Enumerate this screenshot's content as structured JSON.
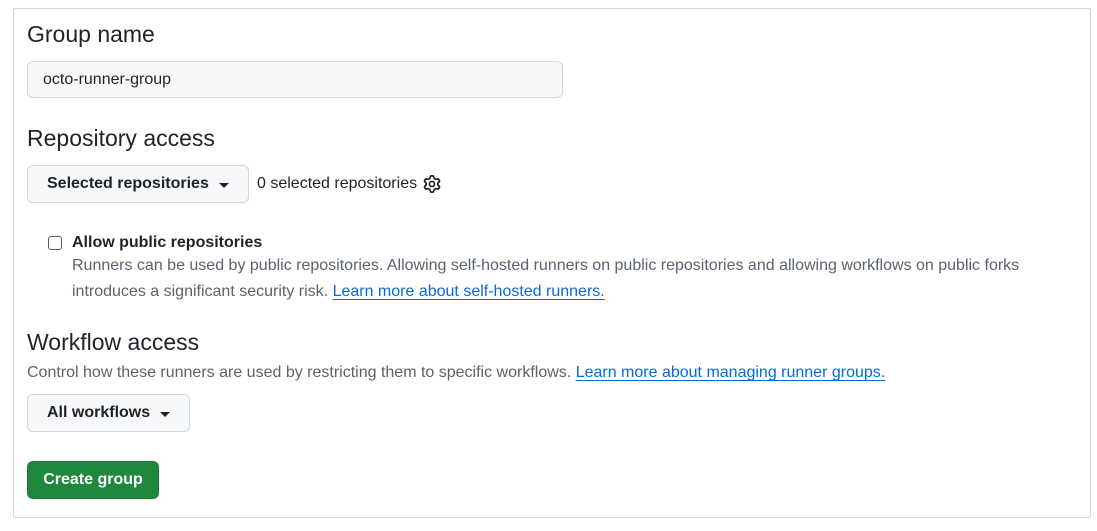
{
  "group_name": {
    "heading": "Group name",
    "value": "octo-runner-group"
  },
  "repository_access": {
    "heading": "Repository access",
    "dropdown_label": "Selected repositories",
    "selected_count_text": "0 selected repositories",
    "settings_icon": "gear-icon",
    "allow_public": {
      "label": "Allow public repositories",
      "checked": false,
      "help_line1": "Runners can be used by public repositories. Allowing self-hosted runners on public repositories and allowing workflows on public forks",
      "help_line2": "introduces a significant security risk.",
      "help_link": "Learn more about self-hosted runners."
    }
  },
  "workflow_access": {
    "heading": "Workflow access",
    "description": "Control how these runners are used by restricting them to specific workflows.",
    "description_link": "Learn more about managing runner groups.",
    "dropdown_label": "All workflows"
  },
  "actions": {
    "create_label": "Create group"
  },
  "colors": {
    "primary_button": "#1f883d",
    "link": "#0969da",
    "muted_text": "#59636e",
    "border": "#d0d7de"
  }
}
